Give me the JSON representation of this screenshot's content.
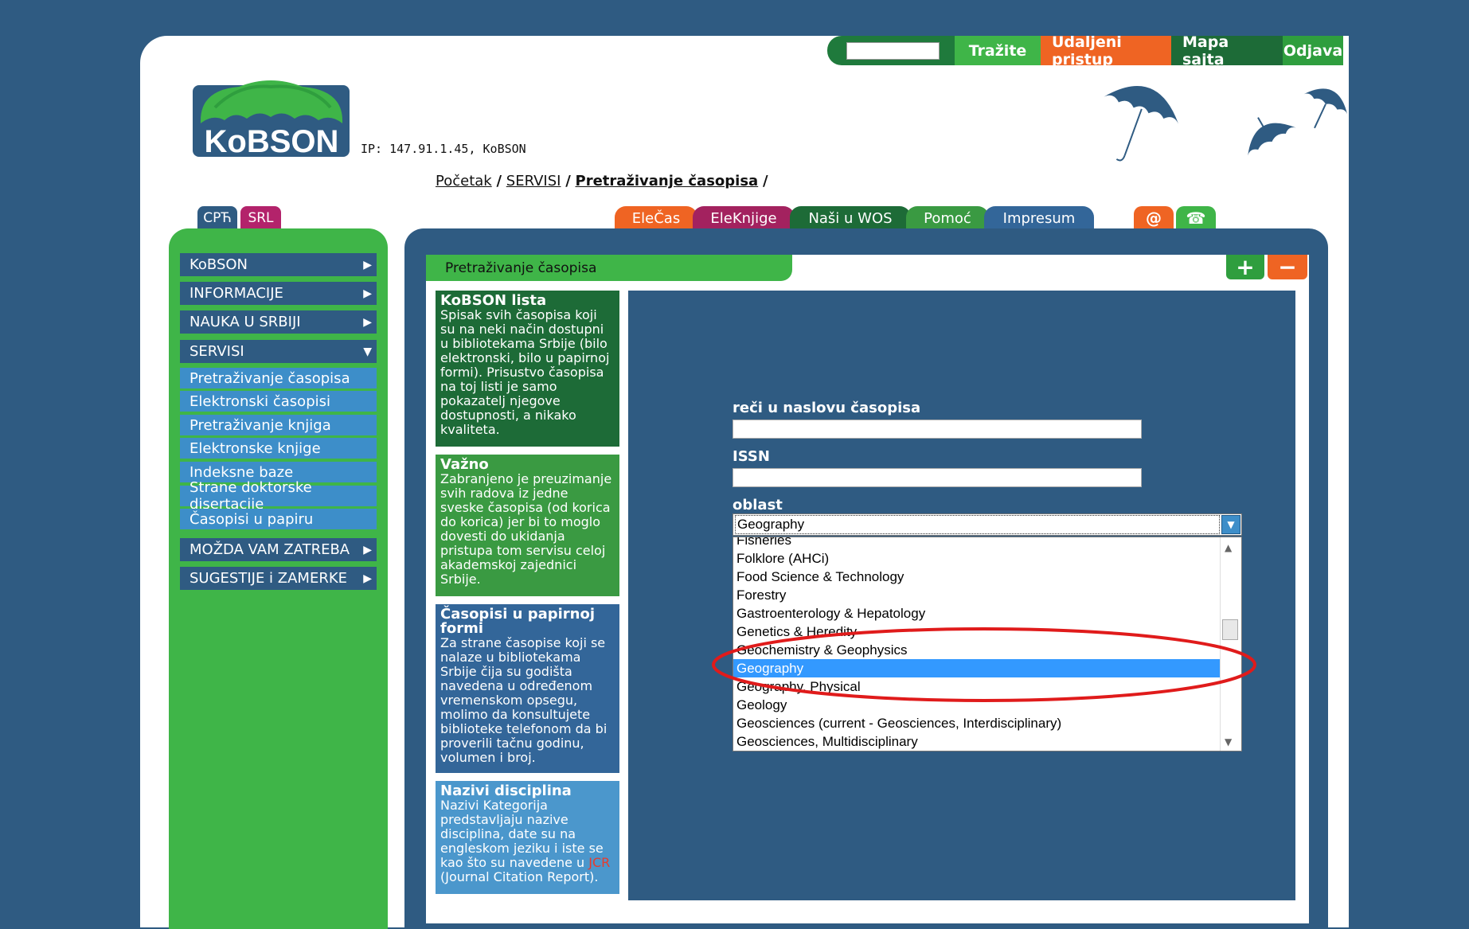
{
  "topbar": {
    "search_label": "Tražite",
    "remote_label": "Udaljeni pristup",
    "sitemap_label": "Mapa sajta",
    "logout_label": "Odjava"
  },
  "logo": {
    "text": "KoBSON"
  },
  "ip_text": "IP: 147.91.1.45, KoBSON",
  "breadcrumb": {
    "home": "Početak",
    "services": "SERVISI",
    "current": "Pretraživanje časopisa",
    "sep": "/"
  },
  "lang": {
    "cyr": "СРЋ",
    "srl": "SRL"
  },
  "navtabs": [
    {
      "label": "EleČas",
      "color": "#ef6423"
    },
    {
      "label": "EleKnjige",
      "color": "#a3225f"
    },
    {
      "label": "Naši u WOS",
      "color": "#1d6b37"
    },
    {
      "label": "Pomoć",
      "color": "#3a9a42"
    },
    {
      "label": "Impresum",
      "color": "#336699"
    }
  ],
  "icons": {
    "mail": "@",
    "phone": "☎"
  },
  "sidebar": {
    "items": [
      {
        "label": "KoBSON",
        "arrow": "▶"
      },
      {
        "label": "INFORMACIJE",
        "arrow": "▶"
      },
      {
        "label": "NAUKA U SRBIJI",
        "arrow": "▶"
      },
      {
        "label": "SERVISI",
        "arrow": "▼"
      }
    ],
    "subitems": [
      "Pretraživanje časopisa",
      "Elektronski časopisi",
      "Pretraživanje knjiga",
      "Elektronske knjige",
      "Indeksne baze",
      "Strane doktorske disertacije",
      "Časopisi u papiru"
    ],
    "bottom_items": [
      {
        "label": "MOŽDA VAM ZATREBA",
        "arrow": "▶"
      },
      {
        "label": "SUGESTIJE i ZAMERKE",
        "arrow": "▶"
      }
    ]
  },
  "section": {
    "title": "Pretraživanje časopisa",
    "plus": "+",
    "minus": "−"
  },
  "boxes": {
    "kobson_lista": {
      "title": "KoBSON lista",
      "text": "Spisak svih časopisa koji su na neki način dostupni u bibliotekama Srbije (bilo elektronski, bilo u papirnoj formi). Prisustvo časopisa na toj listi je samo pokazatelj njegove dostupnosti, a nikako kvaliteta."
    },
    "vazno": {
      "title": "Važno",
      "text": "Zabranjeno je preuzimanje svih radova iz jedne sveske časopisa (od korica do korica) jer bi to moglo dovesti do ukidanja pristupa tom servisu celoj akademskoj zajednici Srbije."
    },
    "papir": {
      "title": "Časopisi u papirnoj formi",
      "text": "Za strane časopise koji se nalaze u bibliotekama Srbije čija su godišta navedena u određenom vremenskom opsegu, molimo da konsultujete biblioteke telefonom da bi proverili tačnu godinu, volumen i broj."
    },
    "discipline": {
      "title": "Nazivi disciplina",
      "text": "Nazivi Kategorija predstavljaju nazive disciplina, date su na engleskom jeziku i iste se kao što su navedene u",
      "link": "JCR",
      "text_after": "(Journal Citation Report)."
    }
  },
  "form": {
    "title_label": "reči u naslovu časopisa",
    "title_value": "",
    "issn_label": "ISSN",
    "issn_value": "",
    "area_label": "oblast",
    "area_selected": "Geography",
    "options": [
      "Fisheries",
      "Folklore (AHCi)",
      "Food Science & Technology",
      "Forestry",
      "Gastroenterology & Hepatology",
      "Genetics & Heredity",
      "Geochemistry & Geophysics",
      "Geography",
      "Geography, Physical",
      "Geology",
      "Geosciences (current - Geosciences, Interdisciplinary)",
      "Geosciences, Multidisciplinary"
    ],
    "selected_index": 7
  },
  "colors": {
    "dark_blue": "#2f5b82",
    "green": "#3fb548",
    "orange": "#ef6423",
    "highlight": "#3399ff",
    "annotation": "#e01b1b"
  }
}
